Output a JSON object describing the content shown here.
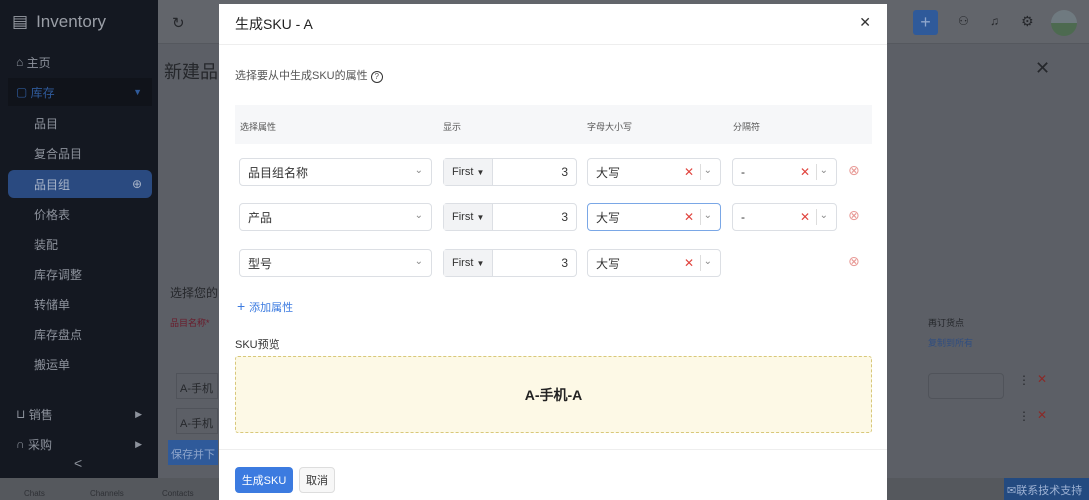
{
  "app": {
    "name": "Inventory"
  },
  "sidebar": {
    "items": [
      {
        "label": "主页",
        "icon": "home-icon"
      },
      {
        "label": "库存",
        "icon": "box-icon"
      },
      {
        "label": "品目"
      },
      {
        "label": "复合品目"
      },
      {
        "label": "品目组"
      },
      {
        "label": "价格表"
      },
      {
        "label": "装配"
      },
      {
        "label": "库存调整"
      },
      {
        "label": "转储单"
      },
      {
        "label": "库存盘点"
      },
      {
        "label": "搬运单"
      },
      {
        "label": "销售",
        "icon": "cart-icon"
      },
      {
        "label": "采购",
        "icon": "bag-icon"
      }
    ],
    "collapse": "<"
  },
  "background": {
    "page_title": "新建品",
    "choose_label": "选择您的",
    "col_item_name": "品目名称*",
    "col_reorder": "再订货点",
    "copy_all": "复制到所有",
    "rows": [
      "A-手机",
      "A-手机"
    ],
    "save_button": "保存并下",
    "support": "联系技术支持"
  },
  "bottombar": [
    "Chats",
    "Channels",
    "Contacts"
  ],
  "modal": {
    "title": "生成SKU - A",
    "subtitle": "选择要从中生成SKU的属性",
    "headers": [
      "选择属性",
      "显示",
      "字母大小写",
      "分隔符"
    ],
    "rows": [
      {
        "attribute": "品目组名称",
        "display": "First",
        "count": "3",
        "case": "大写",
        "separator": "-"
      },
      {
        "attribute": "产品",
        "display": "First",
        "count": "3",
        "case": "大写",
        "separator": "-"
      },
      {
        "attribute": "型号",
        "display": "First",
        "count": "3",
        "case": "大写"
      }
    ],
    "add_attribute": "添加属性",
    "preview_label": "SKU预览",
    "preview_value": "A-手机-A",
    "generate_button": "生成SKU",
    "cancel_button": "取消"
  },
  "colors": {
    "accent": "#3c7be0",
    "sidebar": "#1f2433",
    "danger": "#e0443e",
    "preview_bg": "#fdf9e6"
  }
}
